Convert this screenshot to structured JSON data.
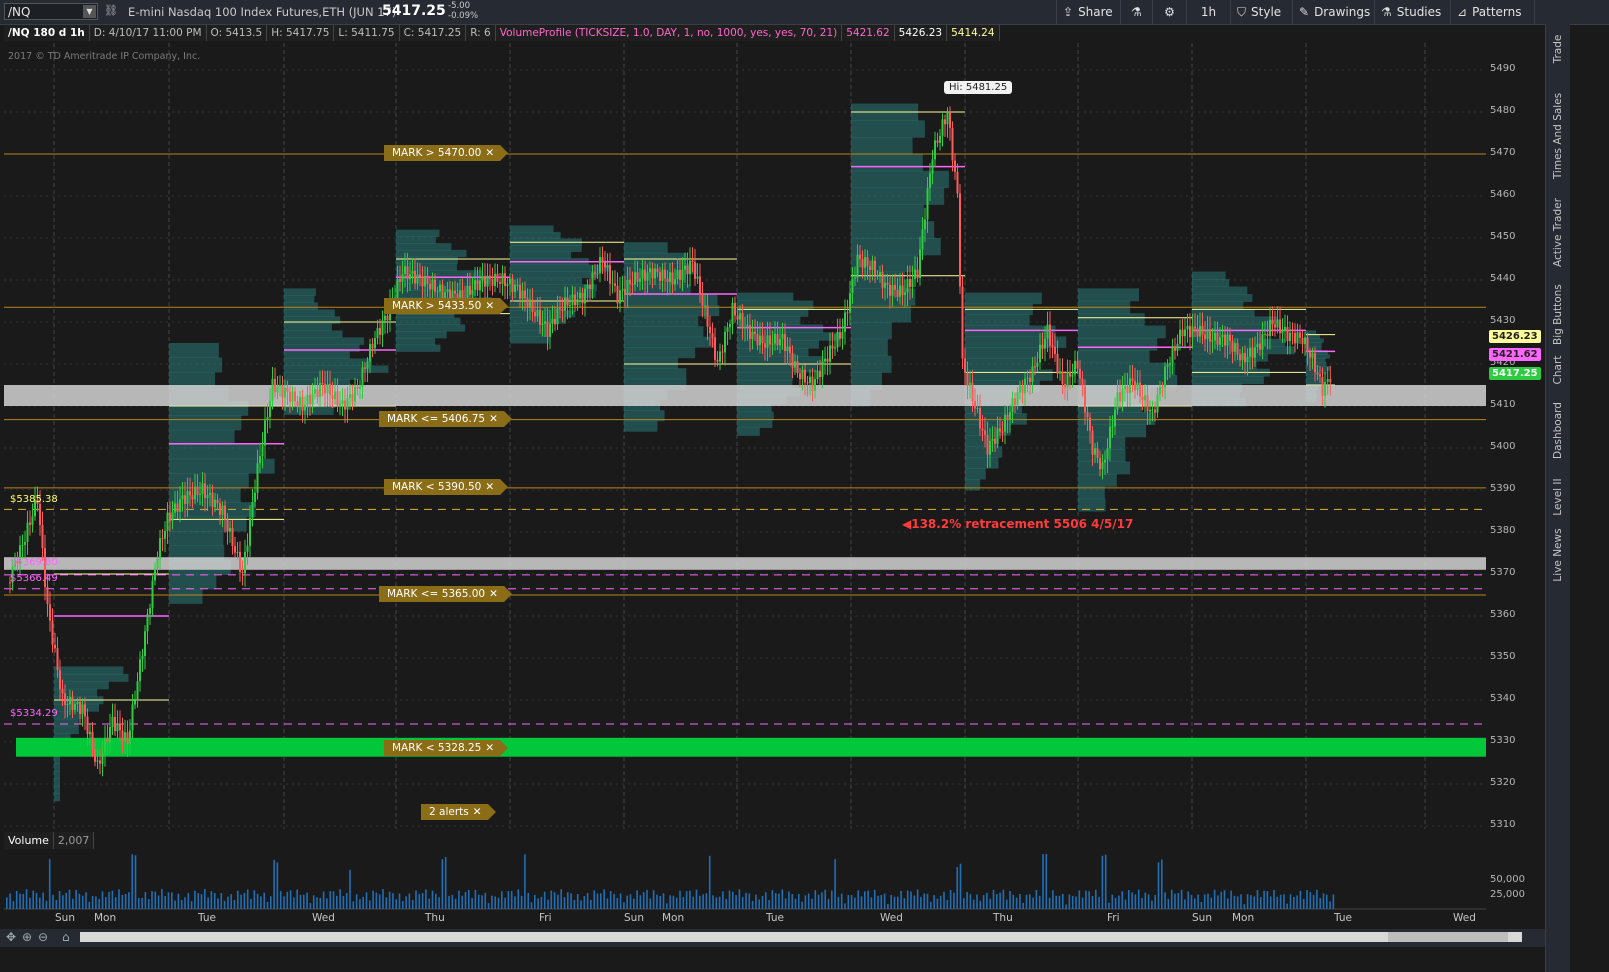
{
  "toolbar": {
    "symbol": "/NQ",
    "title": "E-mini Nasdaq 100 Index Futures,ETH (JUN 17)",
    "last_price": "5417.25",
    "change_abs": "-5.00",
    "change_pct": "-0.09%",
    "share_label": "Share",
    "timeframe_label": "1h",
    "style_label": "Style",
    "drawings_label": "Drawings",
    "studies_label": "Studies",
    "patterns_label": "Patterns"
  },
  "infobar": {
    "chart_id": "/NQ 180 d 1h",
    "date": "D: 4/10/17 11:00 PM",
    "open": "O: 5413.5",
    "high": "H: 5417.75",
    "low": "L: 5411.75",
    "close": "C: 5417.25",
    "range": "R: 6",
    "study": "VolumeProfile (TICKSIZE, 1.0, DAY, 1, no, 1000, yes, yes, 70, 21)",
    "v1": "5421.62",
    "v2": "5426.23",
    "v3": "5414.24"
  },
  "copyright": "2017 © TD Ameritrade IP Company, Inc.",
  "y_ticks": [
    "5490",
    "5480",
    "5470",
    "5460",
    "5450",
    "5440",
    "5430",
    "5420",
    "5410",
    "5400",
    "5390",
    "5380",
    "5370",
    "5360",
    "5350",
    "5340",
    "5330",
    "5320",
    "5310"
  ],
  "price_tags": {
    "t1": "5426.23",
    "t2": "5421.62",
    "t3": "5417.25"
  },
  "marks": {
    "m1": "MARK > 5470.00",
    "m2": "MARK > 5433.50",
    "m3": "MARK <= 5406.75",
    "m4": "MARK < 5390.50",
    "m5": "MARK <= 5365.00",
    "m6": "MARK < 5328.25",
    "alerts": "2 alerts",
    "x": "✕"
  },
  "hi_label": "Hi: 5481.25",
  "retracement": "138.2% retracement 5506 4/5/17",
  "levels": {
    "l1": "5385.38",
    "l2": "5369.80",
    "l3": "5366.49",
    "l4": "5334.29"
  },
  "volume": {
    "label": "Volume",
    "value": "2,007",
    "tick1": "50,000",
    "tick2": "25,000"
  },
  "x_labels": [
    "Sun",
    "Mon",
    "Tue",
    "Wed",
    "Thu",
    "Fri",
    "Sun",
    "Mon",
    "Tue",
    "Wed",
    "Thu",
    "Fri",
    "Sun",
    "Mon",
    "Tue",
    "Wed"
  ],
  "right_tabs": [
    "Trade",
    "Times And Sales",
    "Active Trader",
    "Big Buttons",
    "Chart",
    "Dashboard",
    "Level II",
    "Live News"
  ],
  "colors": {
    "up": "#2ecc40",
    "down": "#ff5b5b",
    "profile": "#2a7a78",
    "mark": "#8b6c17",
    "green_zone": "#00c83a",
    "gray_zone": "#cfcfcf"
  }
}
